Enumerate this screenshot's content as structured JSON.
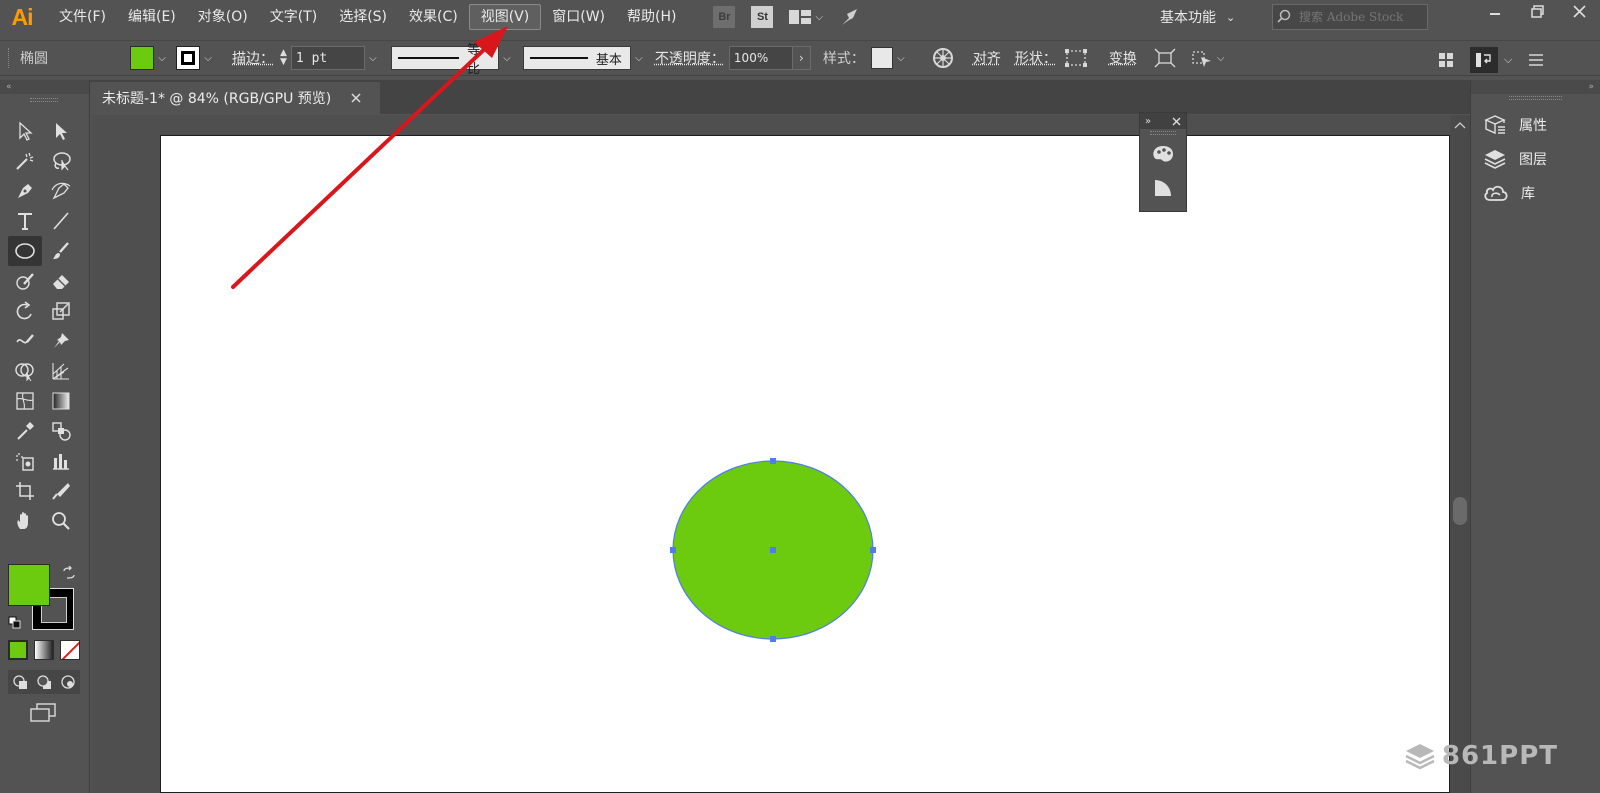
{
  "app": {
    "logo": "Ai"
  },
  "menubar": {
    "items": [
      {
        "label": "文件(F)"
      },
      {
        "label": "编辑(E)"
      },
      {
        "label": "对象(O)"
      },
      {
        "label": "文字(T)"
      },
      {
        "label": "选择(S)"
      },
      {
        "label": "效果(C)"
      },
      {
        "label": "视图(V)",
        "active": true
      },
      {
        "label": "窗口(W)"
      },
      {
        "label": "帮助(H)"
      }
    ],
    "bridge_label": "Br",
    "stock_label": "St",
    "workspace_label": "基本功能",
    "search_placeholder": "搜索 Adobe Stock"
  },
  "controlbar": {
    "object_label": "椭圆",
    "fill_color": "#6dcb0f",
    "stroke_label": "描边：",
    "stroke_weight": "1 pt",
    "variable_width_label": "等比",
    "brush_label": "基本",
    "opacity_label": "不透明度：",
    "opacity_value": "100%",
    "style_label": "样式：",
    "align_label": "对齐",
    "shape_label": "形状：",
    "transform_label": "变换"
  },
  "document": {
    "tab_title": "未标题-1* @ 84% (RGB/GPU 预览)"
  },
  "right_panel": {
    "items": [
      {
        "label": "属性",
        "icon": "properties-icon"
      },
      {
        "label": "图层",
        "icon": "layers-icon"
      },
      {
        "label": "库",
        "icon": "libraries-icon"
      }
    ]
  },
  "canvas": {
    "ellipse_fill": "#6dcb0f",
    "selection_color": "#4f7df0"
  },
  "annotation": {
    "arrow_color": "#d9161b"
  },
  "watermark": {
    "text": "861PPT"
  }
}
